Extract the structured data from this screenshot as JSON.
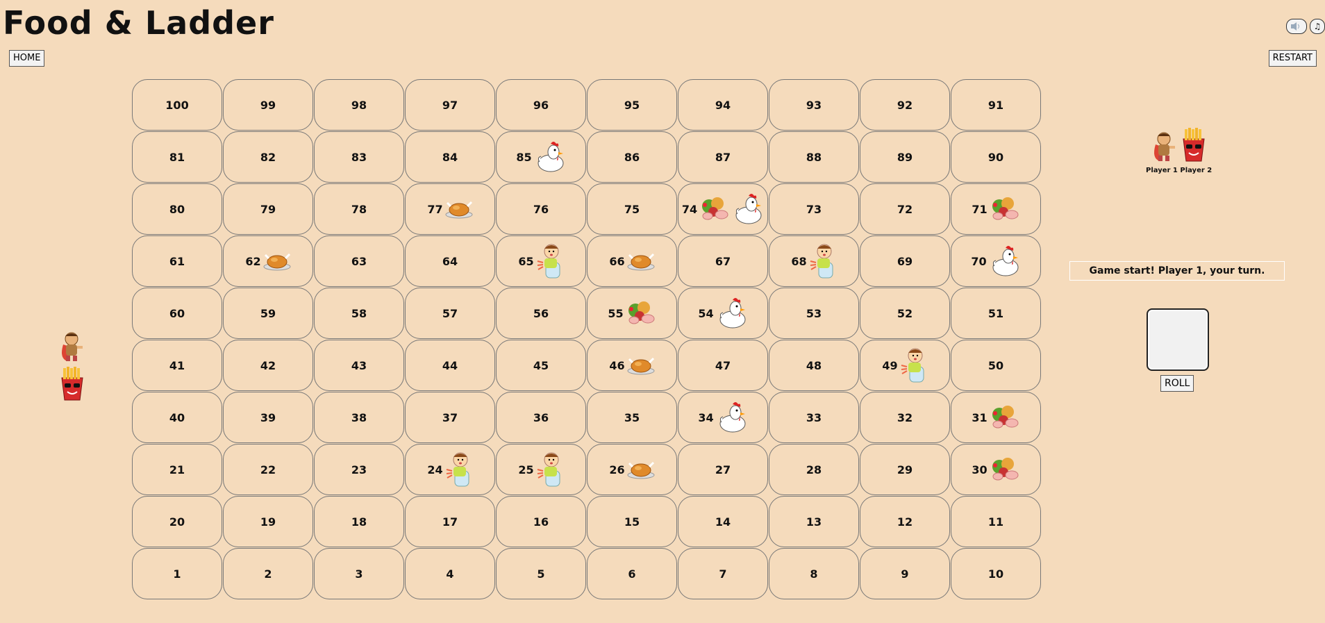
{
  "header": {
    "title": "Food & Ladder"
  },
  "buttons": {
    "home": "HOME",
    "restart": "RESTART",
    "roll": "ROLL"
  },
  "status": "Game start! Player 1, your turn.",
  "players": {
    "p1": "Player 1",
    "p2": "Player 2"
  },
  "top_icons": [
    "sound-toggle-icon",
    "music-icon"
  ],
  "board_rows": [
    [
      100,
      99,
      98,
      97,
      96,
      95,
      94,
      93,
      92,
      91
    ],
    [
      81,
      82,
      83,
      84,
      85,
      86,
      87,
      88,
      89,
      90
    ],
    [
      80,
      79,
      78,
      77,
      76,
      75,
      74,
      73,
      72,
      71
    ],
    [
      61,
      62,
      63,
      64,
      65,
      66,
      67,
      68,
      69,
      70
    ],
    [
      60,
      59,
      58,
      57,
      56,
      55,
      54,
      53,
      52,
      51
    ],
    [
      41,
      42,
      43,
      44,
      45,
      46,
      47,
      48,
      49,
      50
    ],
    [
      40,
      39,
      38,
      37,
      36,
      35,
      34,
      33,
      32,
      31
    ],
    [
      21,
      22,
      23,
      24,
      25,
      26,
      27,
      28,
      29,
      30
    ],
    [
      20,
      19,
      18,
      17,
      16,
      15,
      14,
      13,
      12,
      11
    ],
    [
      1,
      2,
      3,
      4,
      5,
      6,
      7,
      8,
      9,
      10
    ]
  ],
  "cell_items": {
    "85": [
      "chicken"
    ],
    "77": [
      "roast-turkey"
    ],
    "74": [
      "salad-meat",
      "chicken"
    ],
    "71": [
      "salad-meat"
    ],
    "62": [
      "roast-turkey"
    ],
    "65": [
      "sick-boy"
    ],
    "66": [
      "roast-turkey"
    ],
    "68": [
      "sick-boy"
    ],
    "70": [
      "chicken"
    ],
    "55": [
      "salad-meat"
    ],
    "54": [
      "chicken"
    ],
    "46": [
      "roast-turkey"
    ],
    "49": [
      "sick-boy"
    ],
    "34": [
      "chicken"
    ],
    "31": [
      "salad-meat"
    ],
    "24": [
      "sick-boy"
    ],
    "25": [
      "sick-boy"
    ],
    "26": [
      "roast-turkey"
    ],
    "30": [
      "salad-meat"
    ]
  }
}
